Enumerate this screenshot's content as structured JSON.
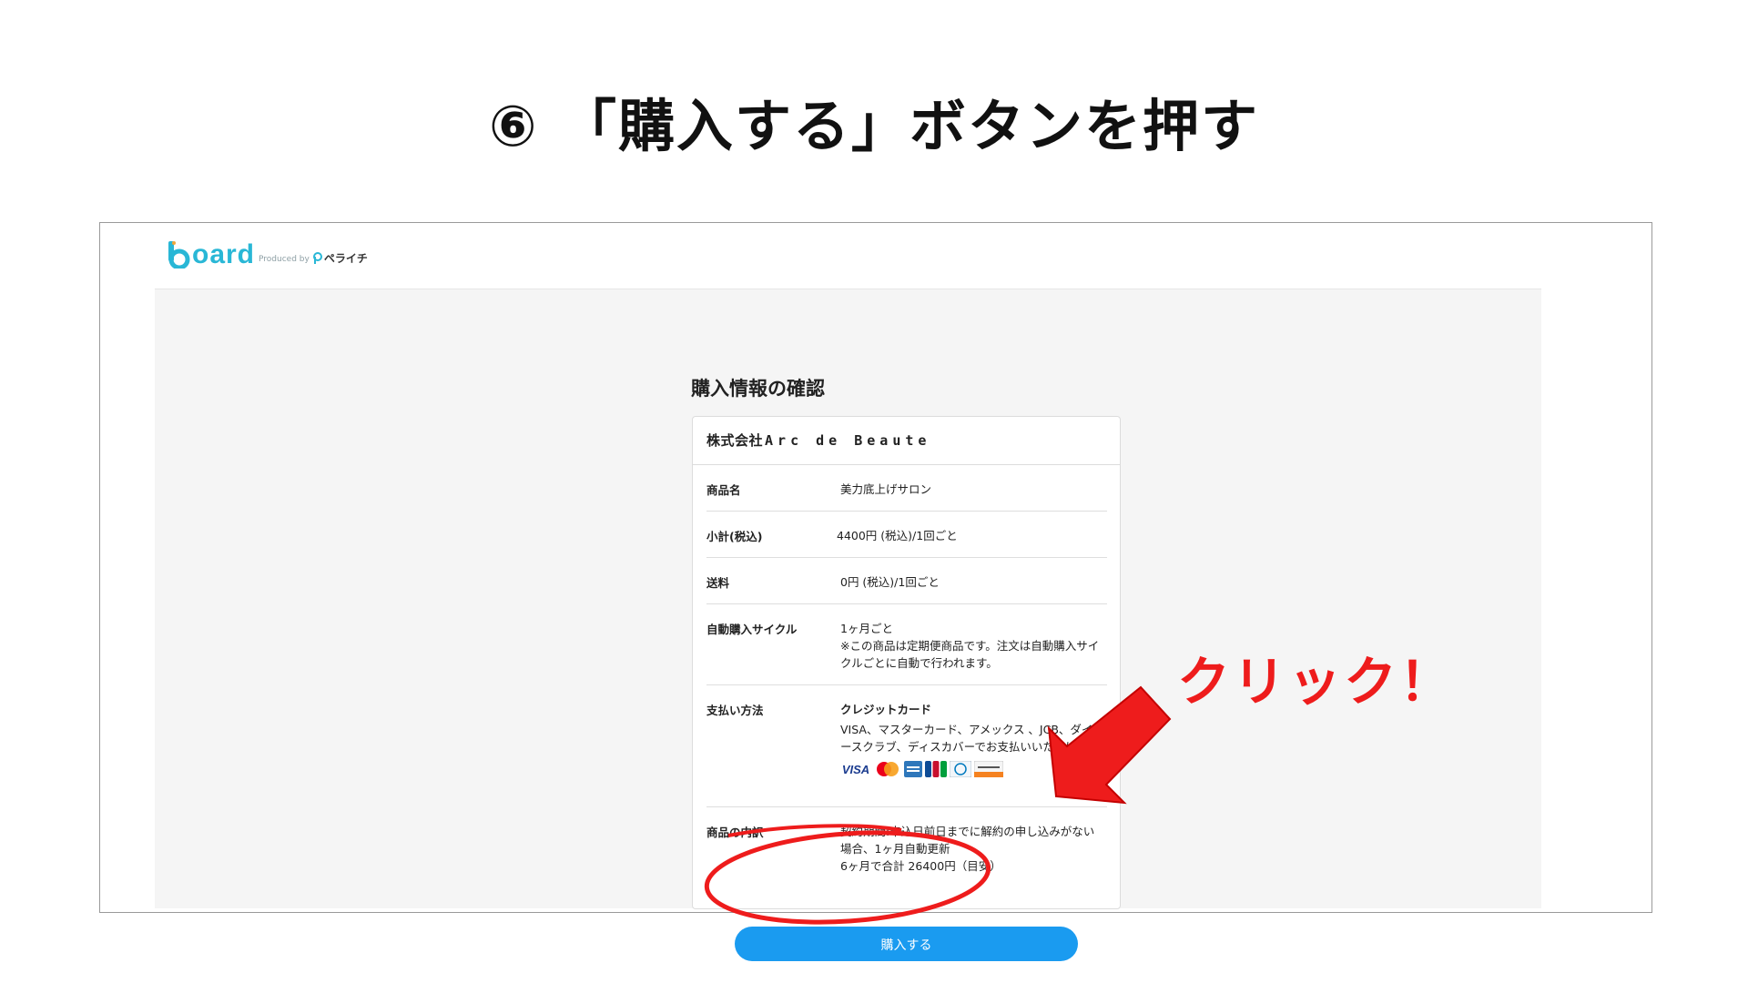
{
  "instruction": {
    "title": "⑥ 「購入する」ボタンを押す",
    "callout": "クリック！"
  },
  "header": {
    "logo_text": "oard",
    "produced_by": "Produced by",
    "brand": "ペライチ"
  },
  "page": {
    "heading": "購入情報の確認",
    "shop_name_jp": "株式会社",
    "shop_name_en": "Arc de Beaute",
    "rows": [
      {
        "label": "商品名",
        "value": "美力底上げサロン"
      },
      {
        "label": "小計(税込)",
        "value": "4400円 (税込)/1回ごと"
      },
      {
        "label": "送料",
        "value": "0円 (税込)/1回ごと"
      },
      {
        "label": "自動購入サイクル",
        "value_line1": "1ヶ月ごと",
        "value_note": "※この商品は定期便商品です。注文は自動購入サイクルごとに自動で行われます。"
      },
      {
        "label": "支払い方法",
        "value_title": "クレジットカード",
        "value_note": "VISA、マスターカード、アメックス 、JCB、ダイナースクラブ、ディスカバーでお支払いいただけます"
      },
      {
        "label": "商品の内訳",
        "value": "契約期間:申込日前日までに解約の申し込みがない場合、1ヶ月自動更新",
        "value_line2": "6ヶ月で合計  26400円（目安）"
      }
    ],
    "card_brands": [
      "VISA",
      "Mastercard",
      "AMEX",
      "JCB",
      "Diners",
      "DISCOVER"
    ],
    "buy_button": "購入する"
  },
  "colors": {
    "accent": "#1a9bf0",
    "logo": "#29b7d6",
    "callout_red": "#ee1c1c"
  }
}
